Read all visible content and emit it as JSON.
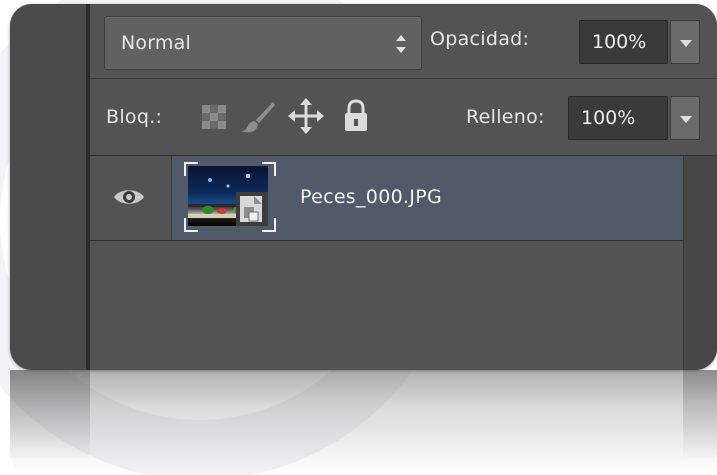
{
  "layers_panel": {
    "blend_mode": {
      "selected": "Normal",
      "icon": "up-down-arrows-icon"
    },
    "opacity": {
      "label": "Opacidad:",
      "value": "100%",
      "dropdown_icon": "triangle-down-icon"
    },
    "lock": {
      "label": "Bloq.:",
      "icons": [
        "lock-transparent-pixels-icon",
        "lock-image-pixels-icon",
        "lock-position-icon",
        "lock-all-icon"
      ]
    },
    "fill": {
      "label": "Relleno:",
      "value": "100%",
      "dropdown_icon": "triangle-down-icon"
    },
    "layers": [
      {
        "name": "Peces_000.JPG",
        "visible": true,
        "type": "smart-object",
        "selected": true
      }
    ]
  },
  "colors": {
    "panel_bg": "#535353",
    "selected_row": "#505a69",
    "field_bg": "#3a3a3a",
    "text": "#e6e6e6"
  }
}
